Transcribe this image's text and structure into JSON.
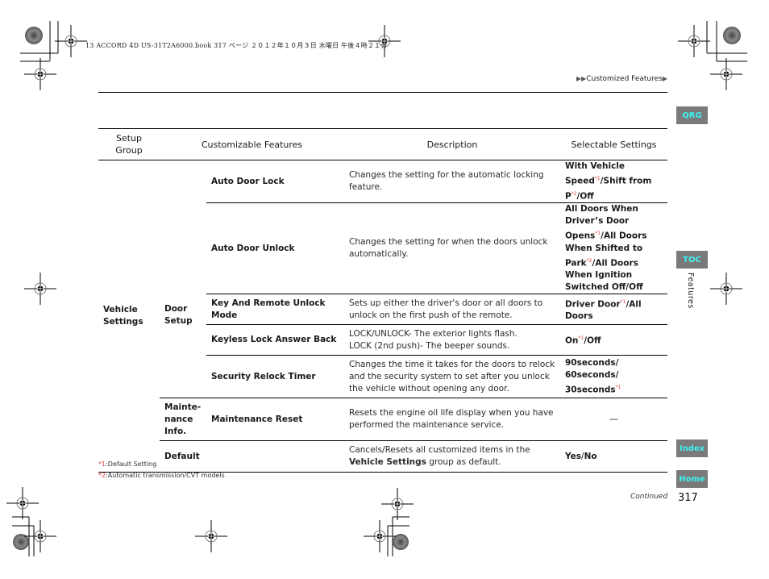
{
  "print_header": "13 ACCORD 4D US-31T2A6000.book  317 ページ  ２０１２年１０月３日  水曜日  午後４時２１分",
  "breadcrumb": {
    "prefix_icon": "double-arrow-right-icon",
    "label": "Customized Features",
    "suffix_icon": "arrow-right-icon"
  },
  "side_tabs": {
    "qrg": "QRG",
    "toc": "TOC",
    "section_label": "Features",
    "index": "Index",
    "home": "Home"
  },
  "colors": {
    "tab_bg": "#7a7a7a",
    "tab_text": "#3ff2f2",
    "footnote_mark": "#e04040"
  },
  "table": {
    "headers": [
      "Setup Group",
      "Customizable Features",
      "Description",
      "Selectable Settings"
    ],
    "group": "Vehicle Settings",
    "subgroups": {
      "door_setup": "Door Setup",
      "maintenance_info": "Mainte-nance Info.",
      "default": "Default"
    },
    "rows": [
      {
        "feature": "Auto Door Lock",
        "description": "Changes the setting for the automatic locking feature.",
        "settings": [
          {
            "text": "With Vehicle Speed",
            "mark": "*1"
          },
          {
            "text": "/Shift from P",
            "mark": "*2"
          },
          {
            "text": "/Off",
            "mark": ""
          }
        ]
      },
      {
        "feature": "Auto Door Unlock",
        "description": "Changes the setting for when the doors unlock automatically.",
        "settings": [
          {
            "text": "All Doors When Driver’s Door Opens",
            "mark": "*1"
          },
          {
            "text": "/All Doors When Shifted to Park",
            "mark": "*2"
          },
          {
            "text": "/All Doors When Ignition Switched Off/Off",
            "mark": ""
          }
        ]
      },
      {
        "feature": "Key And Remote Unlock Mode",
        "description": "Sets up either the driver's door or all doors to unlock on the first push of the remote.",
        "settings": [
          {
            "text": "Driver Door",
            "mark": "*1"
          },
          {
            "text": "/All Doors",
            "mark": ""
          }
        ]
      },
      {
        "feature": "Keyless Lock Answer Back",
        "description_lines": [
          "LOCK/UNLOCK- The exterior lights flash.",
          "LOCK (2nd push)- The beeper sounds."
        ],
        "settings": [
          {
            "text": "On",
            "mark": "*1"
          },
          {
            "text": "/Off",
            "mark": ""
          }
        ]
      },
      {
        "feature": "Security Relock Timer",
        "description": "Changes the time it takes for the doors to relock and the security system to set after you unlock the vehicle without opening any door.",
        "settings": [
          {
            "text": "90seconds/",
            "mark": ""
          },
          {
            "text": "60seconds/",
            "mark": ""
          },
          {
            "text": "30seconds",
            "mark": "*1"
          }
        ]
      },
      {
        "feature": "Maintenance Reset",
        "description": "Resets the engine oil life display when you have performed the maintenance service.",
        "settings_text": "—"
      },
      {
        "feature": "",
        "description_pre": "Cancels/Resets all customized items in the ",
        "description_bold": "Vehicle Settings",
        "description_post": " group as default.",
        "settings_parts": [
          "Yes",
          "/",
          "No"
        ]
      }
    ]
  },
  "footnotes": [
    {
      "mark": "*1",
      "text": ":Default Setting"
    },
    {
      "mark": "*2",
      "text": ":Automatic transmission/CVT models"
    }
  ],
  "footer": {
    "continued": "Continued",
    "page_number": "317"
  }
}
